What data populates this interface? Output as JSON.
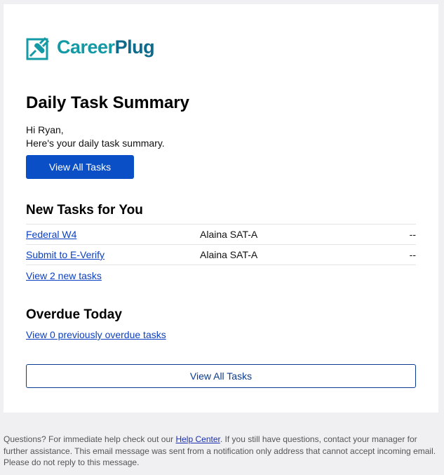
{
  "brand": {
    "name_part1": "Career",
    "name_part2": "Plug",
    "colors": {
      "teal": "#139aa4",
      "dark_teal": "#0d6a8b"
    },
    "icon": "careerplug-plug-icon"
  },
  "header": {
    "title": "Daily Task Summary",
    "greeting_line1": "Hi Ryan,",
    "greeting_line2": "Here's your daily task summary.",
    "view_all_label": "View All Tasks"
  },
  "new_tasks": {
    "title": "New Tasks for You",
    "rows": [
      {
        "name": "Federal W4",
        "person": "Alaina SAT-A",
        "due": "--"
      },
      {
        "name": "Submit to E-Verify",
        "person": "Alaina SAT-A",
        "due": "--"
      }
    ],
    "view_link": "View 2 new tasks"
  },
  "overdue": {
    "title": "Overdue Today",
    "view_link": "View 0 previously overdue tasks"
  },
  "bottom": {
    "view_all_label": "View All Tasks"
  },
  "footer": {
    "text_before_link": "Questions? For immediate help check out our ",
    "help_link": "Help Center",
    "text_after_link": ". If you still have questions, contact your manager for further assistance. This email message was sent from a notification only address that cannot accept incoming email. Please do not reply to this message."
  },
  "colors": {
    "primary_button": "#0b4fc6",
    "link": "#0b3fc1",
    "page_bg": "#f0f0f2"
  }
}
